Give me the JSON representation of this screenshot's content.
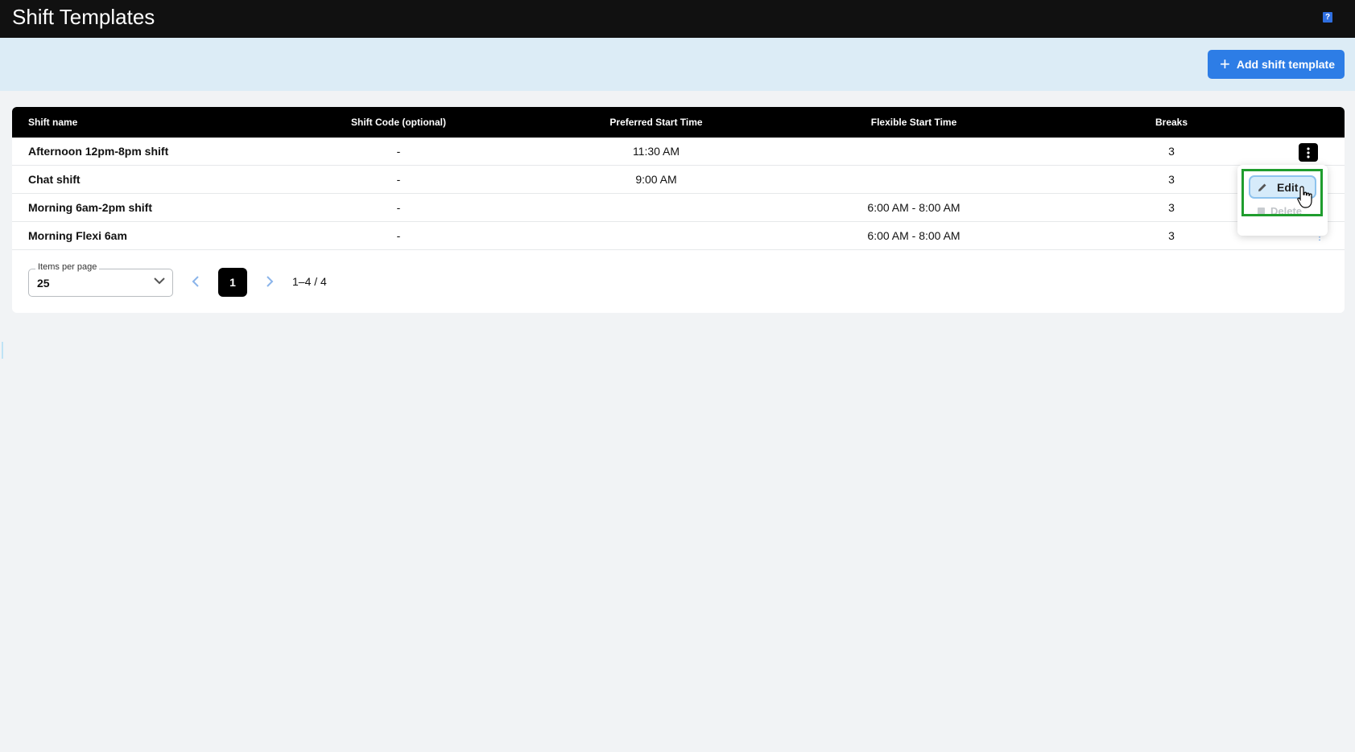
{
  "header": {
    "title": "Shift Templates",
    "help_icon": "?"
  },
  "toolbar": {
    "add_label": "Add shift template",
    "add_icon": "plus-icon",
    "accent": "#2d7de6"
  },
  "table": {
    "columns": {
      "name": "Shift name",
      "code": "Shift Code (optional)",
      "pref": "Preferred Start Time",
      "flex": "Flexible Start Time",
      "breaks": "Breaks"
    },
    "rows": [
      {
        "name": "Afternoon 12pm-8pm shift",
        "code": "-",
        "pref": "11:30 AM",
        "flex": "",
        "breaks": "3"
      },
      {
        "name": "Chat shift",
        "code": "-",
        "pref": "9:00 AM",
        "flex": "",
        "breaks": "3"
      },
      {
        "name": "Morning 6am-2pm shift",
        "code": "-",
        "pref": "",
        "flex": "6:00 AM - 8:00 AM",
        "breaks": "3"
      },
      {
        "name": "Morning Flexi 6am",
        "code": "-",
        "pref": "",
        "flex": "6:00 AM - 8:00 AM",
        "breaks": "3"
      }
    ]
  },
  "pagination": {
    "items_per_page_label": "Items per page",
    "items_per_page_value": "25",
    "current_page": "1",
    "range": "1–4 / 4"
  },
  "row_menu": {
    "edit_label": "Edit",
    "delete_label": "Delete"
  }
}
